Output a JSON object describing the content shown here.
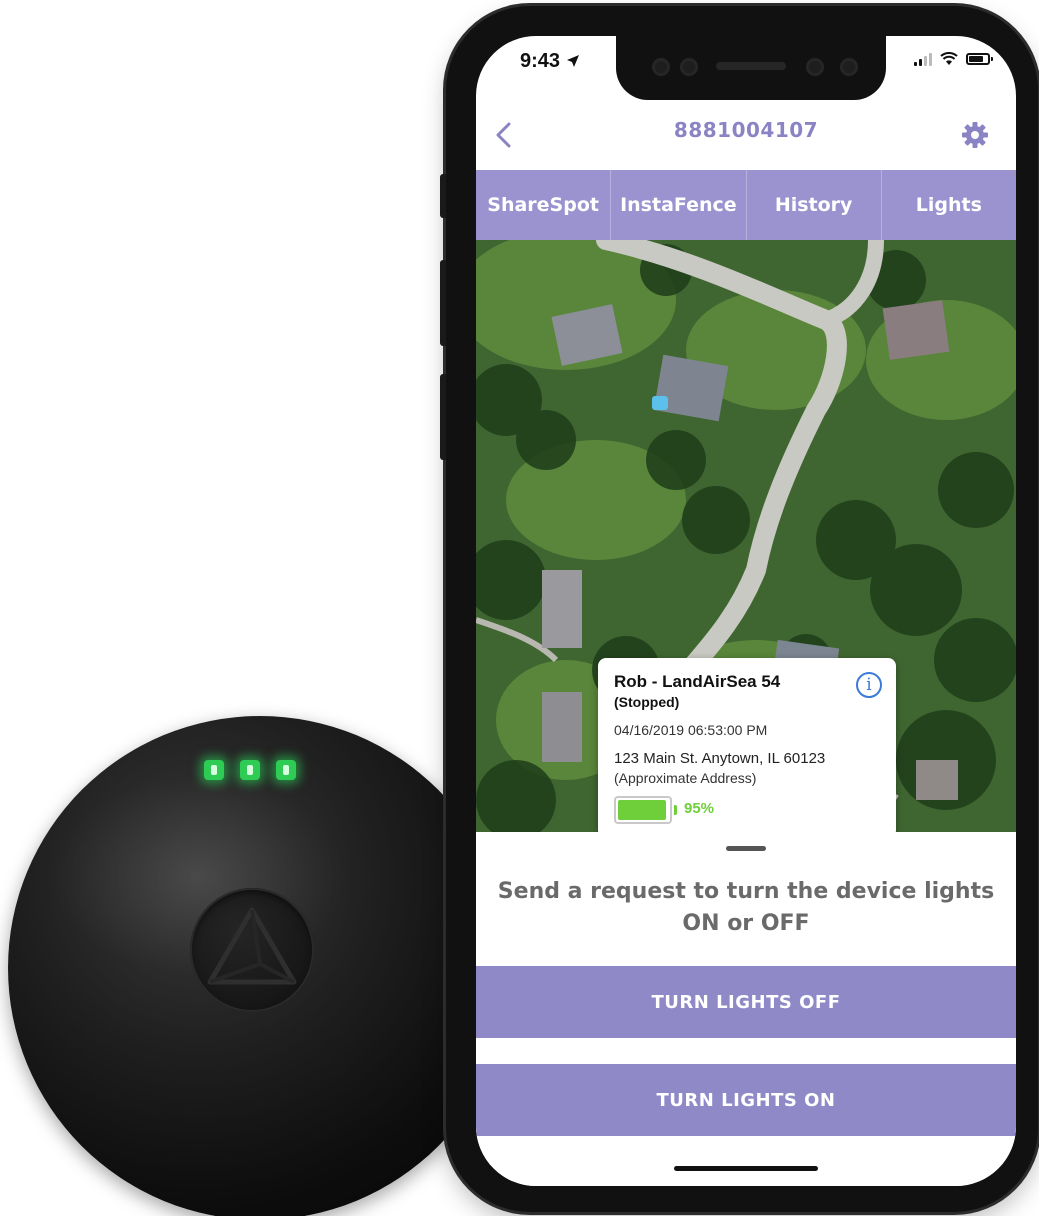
{
  "status_bar": {
    "time": "9:43"
  },
  "header": {
    "device_id": "8881004107"
  },
  "tabs": [
    {
      "label": "ShareSpot"
    },
    {
      "label": "InstaFence"
    },
    {
      "label": "History"
    },
    {
      "label": "Lights"
    }
  ],
  "popup": {
    "name": "Rob - LandAirSea 54",
    "state": "(Stopped)",
    "timestamp": "04/16/2019 06:53:00 PM",
    "address": "123 Main St. Anytown, IL 60123",
    "address_note": "(Approximate Address)",
    "battery_percent_label": "95%",
    "battery_level": 0.95,
    "info_icon": "i"
  },
  "sheet": {
    "prompt": "Send a request to turn the device lights ON or OFF",
    "off_button": "TURN LIGHTS OFF",
    "on_button": "TURN LIGHTS ON"
  },
  "colors": {
    "accent": "#8f89c8",
    "tab_bar": "#9a93cf",
    "device_id": "#8a84c4",
    "battery_green": "#6fcf3a",
    "led_green": "#2ecc55",
    "info_blue": "#3b7ad8"
  },
  "icons": {
    "back": "chevron-left-icon",
    "settings": "gear-icon",
    "info": "info-icon",
    "location_arrow": "location-arrow-icon",
    "signal": "cellular-signal-icon",
    "wifi": "wifi-icon",
    "battery": "battery-icon",
    "vehicle": "car-icon"
  }
}
